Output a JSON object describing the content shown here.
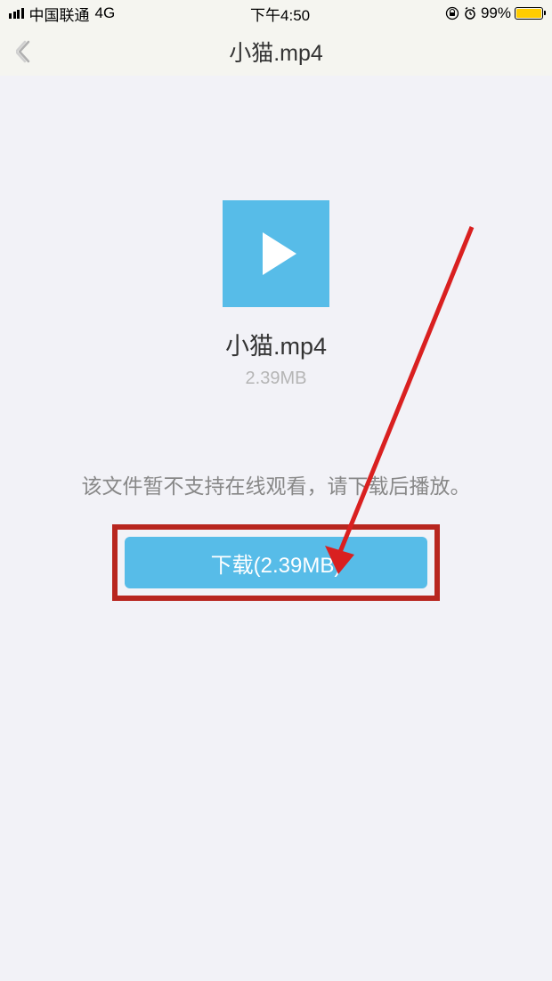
{
  "status_bar": {
    "carrier": "中国联通",
    "network": "4G",
    "time": "下午4:50",
    "battery_percent": "99%"
  },
  "header": {
    "title": "小猫.mp4"
  },
  "file": {
    "name": "小猫.mp4",
    "size": "2.39MB"
  },
  "hint": "该文件暂不支持在线观看，请下载后播放。",
  "download_button_label": "下载(2.39MB)"
}
